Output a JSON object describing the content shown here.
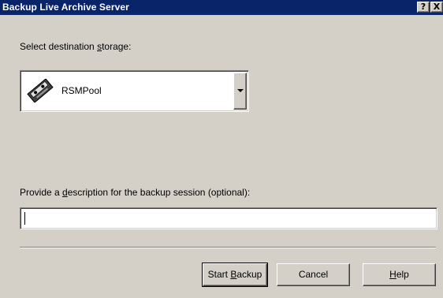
{
  "window": {
    "title": "Backup Live Archive Server",
    "help_glyph": "?",
    "close_glyph": "X"
  },
  "destination": {
    "label_pre": "Select destination ",
    "label_key": "s",
    "label_post": "torage:",
    "selected": "RSMPool",
    "icon": "tape-cartridge-icon"
  },
  "description": {
    "label_pre": "Provide a ",
    "label_key": "d",
    "label_post": "escription for the backup session (optional):",
    "value": "",
    "placeholder": ""
  },
  "buttons": {
    "start_pre": "Start ",
    "start_key": "B",
    "start_post": "ackup",
    "cancel": "Cancel",
    "help_key": "H",
    "help_post": "elp"
  }
}
